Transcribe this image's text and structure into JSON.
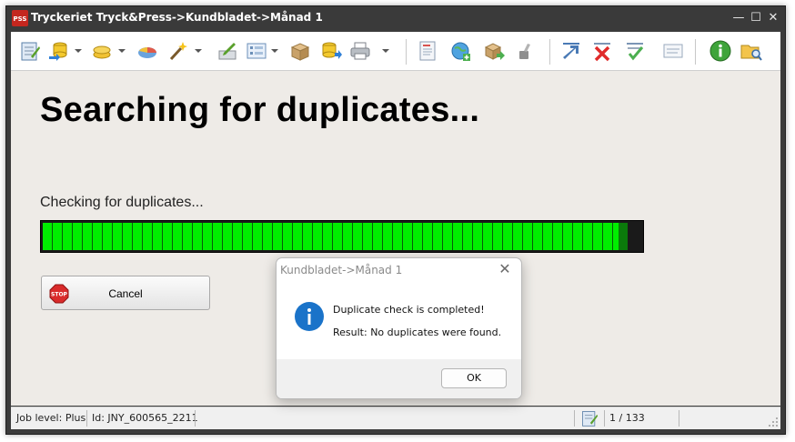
{
  "window": {
    "title": "Tryckeriet Tryck&Press->Kundbladet->Månad 1",
    "logo_text": "PSS",
    "controls": {
      "minimize": "—",
      "maximize": "☐",
      "close": "✕"
    }
  },
  "toolbar": {
    "icons": [
      "notepad-icon",
      "database-import-icon",
      "coins-icon",
      "pie-chart-icon",
      "magic-wand-icon",
      "edit-document-icon",
      "form-list-icon",
      "package-icon",
      "database-export-icon",
      "printer-icon",
      "document-address-icon",
      "globe-add-icon",
      "package-forward-icon",
      "tools-icon",
      "arrow-up-right-icon",
      "delete-x-icon",
      "checklist-icon",
      "form-icon",
      "info-icon",
      "folder-search-icon"
    ]
  },
  "main": {
    "heading": "Searching for duplicates...",
    "status_text": "Checking for duplicates...",
    "progress_fraction": 0.98,
    "cancel_label": "Cancel",
    "stop_icon_text": "STOP"
  },
  "statusbar": {
    "job_level": "Job level: Plus",
    "job_id": "Id: JNY_600565_2211",
    "page_counter": "1 / 133"
  },
  "dialog": {
    "title": "Kundbladet->Månad 1",
    "close_glyph": "✕",
    "message": "Duplicate check is completed!",
    "result": "Result: No duplicates were found.",
    "ok_label": "OK"
  },
  "colors": {
    "progress_green": "#00ee00",
    "content_bg": "#eeebe7",
    "titlebar_bg": "#3a3a3a",
    "info_blue": "#1a73c9"
  }
}
